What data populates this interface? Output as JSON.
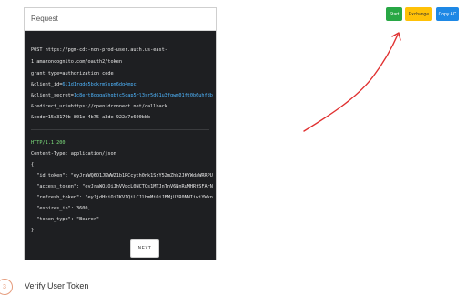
{
  "panel": {
    "title": "Request",
    "request_lines": [
      "POST https://pgm-cdt-non-prod-user.auth.us-east-",
      "1.amazoncognito.com/oauth2/token",
      "grant_type=authorization_code",
      "&client_id=",
      "&client_secret=",
      "&redirect_uri=https://openidconnect.net/callback",
      "&code=15e3170b-801e-4b75-a3de-922a7c600bbb"
    ],
    "client_id_value": "6l1d1rgde5bckrm5spm6dg4mpc",
    "client_secret_value": "1c8ert8oqqa5hgbjc5cap5rl3sr5d61u3fgwm01ft0b6uhfdb",
    "response_lines": [
      "HTTP/1.1 200",
      "Content-Type: application/json",
      "{",
      "  \"id_token\": \"eyJraWQ6O1JKWWZ1b1RCcyth0nk1SzY5ZmZhb2JKYWdaWRRPU",
      "  \"access_token\": \"eyJraWQiOiJhVVpcL0NCTCs1MTJnTnV6NnRuMHRtSFArN",
      "  \"refresh_token\": \"eyJjdHkiOiJKV1QiLCJlbmMiOiJBMjU2R0NNIiwiYWxn",
      "  \"expires_in\": 3600,",
      "  \"token_type\": \"Bearer\"",
      "}"
    ],
    "next_label": "NEXT"
  },
  "controls": {
    "start_label": "Start",
    "exchange_label": "Exchange",
    "copy_label": "Copy AC"
  },
  "step": {
    "number": "3",
    "title": "Verify User Token"
  },
  "colors": {
    "code_bg": "#1e1f22",
    "highlight_blue": "#4fb6ff",
    "http_green": "#7ee07e",
    "start": "#28a745",
    "exchange": "#ffc107",
    "copy": "#1e88e5",
    "annotation": "#e03030"
  }
}
